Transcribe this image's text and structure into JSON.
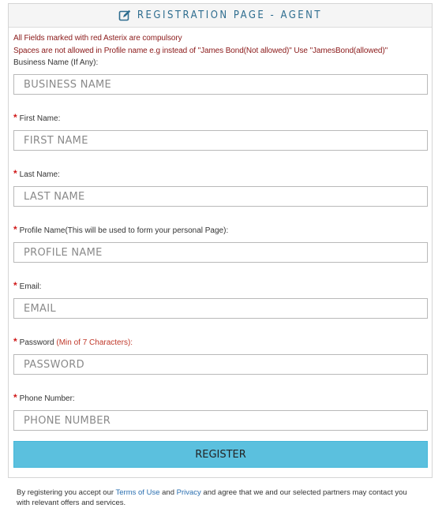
{
  "header": {
    "title": "REGISTRATION PAGE - AGENT",
    "icon": "edit-icon"
  },
  "notices": {
    "line1": "All Fields marked with red Asterix are compulsory",
    "line2": "Spaces are not allowed in Profile name e.g instead of  \"James Bond(Not allowed)\"  Use \"JamesBond(allowed)\""
  },
  "fields": {
    "business": {
      "label": "Business Name (If Any):",
      "placeholder": "BUSINESS NAME",
      "value": ""
    },
    "first_name": {
      "label": "First Name:",
      "placeholder": "FIRST NAME",
      "value": ""
    },
    "last_name": {
      "label": "Last Name:",
      "placeholder": "LAST NAME",
      "value": ""
    },
    "profile": {
      "label": "Profile Name(This will be used to form your personal Page):",
      "placeholder": "PROFILE NAME",
      "value": ""
    },
    "email": {
      "label": "Email:",
      "placeholder": "EMAIL",
      "value": ""
    },
    "password": {
      "label": "Password ",
      "hint": "(Min of 7 Characters):",
      "placeholder": "PASSWORD",
      "value": ""
    },
    "phone": {
      "label": "Phone Number:",
      "placeholder": "PHONE NUMBER",
      "value": ""
    }
  },
  "required_marker": "*",
  "register_label": "REGISTER",
  "terms": {
    "prefix": "By registering you accept our ",
    "terms_link": "Terms of Use",
    "and1": " and ",
    "privacy_link": "Privacy",
    "suffix": " and agree that we and our selected partners may contact you with relevant offers and services."
  },
  "colors": {
    "header_text": "#2e6d8f",
    "notice_text": "#8b1a1a",
    "required": "#d01919",
    "button": "#5bc0de",
    "link": "#2a6fb0"
  }
}
